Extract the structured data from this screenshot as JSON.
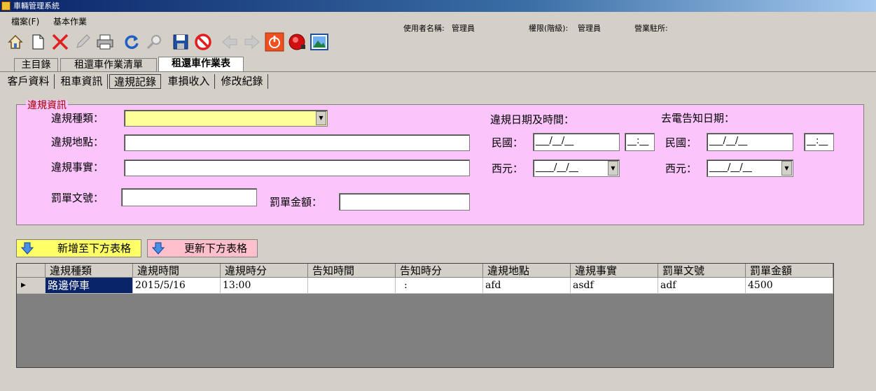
{
  "window": {
    "title": "車輛管理系統"
  },
  "menu": {
    "file": "檔案(F)",
    "basic": "基本作業"
  },
  "userinfo": {
    "user_label": "使用者名稱:",
    "user_value": "管理員",
    "perm_label": "權限(階級):",
    "perm_value": "管理員",
    "office_label": "營業駐所:"
  },
  "toolbar": {
    "icons": [
      "home-icon",
      "new-document-icon",
      "delete-icon",
      "edit-icon",
      "print-icon",
      "refresh-icon",
      "search-icon",
      "save-icon",
      "cancel-icon",
      "back-icon",
      "forward-icon",
      "power-icon",
      "alarm-icon",
      "picture-icon"
    ]
  },
  "main_tabs": [
    "主目錄",
    "租還車作業清單",
    "租還車作業表"
  ],
  "sub_tabs": [
    "客戶資料",
    "租車資訊",
    "違規記錄",
    "車損收入",
    "修改紀錄"
  ],
  "panel": {
    "legend": "違規資訊",
    "type_label": "違規種類：",
    "place_label": "違規地點：",
    "fact_label": "違規事實：",
    "ticket_no_label": "罰單文號：",
    "amount_label": "罰單金額：",
    "datetime_label": "違規日期及時間：",
    "notify_label": "去電告知日期：",
    "roc_label": "民國：",
    "ad_label": "西元：",
    "roc_mask": "___/__/__",
    "time_mask": "__:__",
    "ad_mask": "____/__/__",
    "type_value": "",
    "place_value": "",
    "fact_value": "",
    "ticket_no_value": "",
    "amount_value": ""
  },
  "buttons": {
    "add": "新增至下方表格",
    "update": "更新下方表格"
  },
  "grid": {
    "columns": [
      "違規種類",
      "違規時間",
      "違規時分",
      "告知時間",
      "告知時分",
      "違規地點",
      "違規事實",
      "罰單文號",
      "罰單金額"
    ],
    "rows": [
      [
        "路邊停車",
        "2015/5/16",
        "13:00",
        "",
        ":",
        "afd",
        "asdf",
        "adf",
        "4500"
      ]
    ]
  },
  "colors": {
    "panel_bg": "#fbc4fb",
    "add_button": "#ffff66",
    "update_button": "#ffc0cb",
    "selected_cell": "#0a246a"
  }
}
